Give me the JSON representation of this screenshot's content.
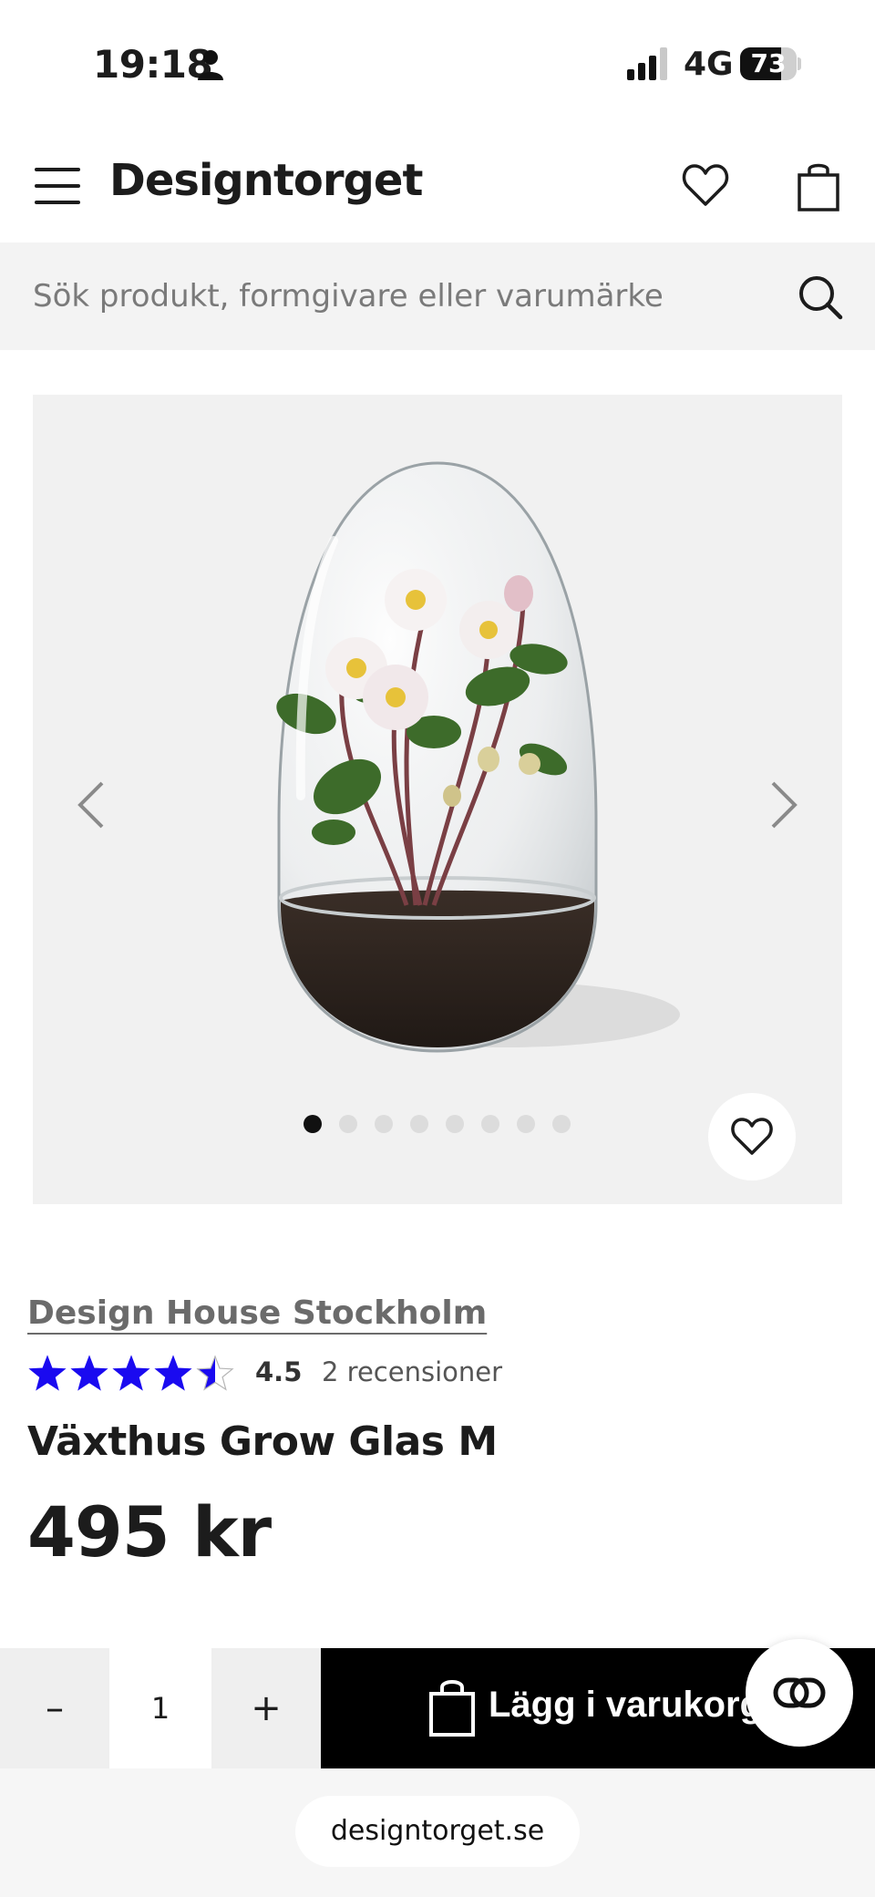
{
  "status_bar": {
    "time": "19:18",
    "network": "4G",
    "battery": "73",
    "battery_level": 0.73
  },
  "header": {
    "logo": "Designtorget",
    "menu_icon": "hamburger-menu-icon",
    "wishlist_icon": "heart-icon",
    "cart_icon": "shopping-bag-icon"
  },
  "search": {
    "placeholder": "Sök produkt, formgivare eller varumärke",
    "icon": "search-icon"
  },
  "gallery": {
    "image_alt": "product-photo",
    "image_count": 8,
    "active_index": 0,
    "prev_icon": "chevron-left-icon",
    "next_icon": "chevron-right-icon",
    "favorite_icon": "heart-icon"
  },
  "product": {
    "brand": "Design House Stockholm",
    "rating": 4.5,
    "rating_label": "4.5",
    "review_count": "2 recensioner",
    "title": "Växthus Grow Glas M",
    "price": "495 kr"
  },
  "cart": {
    "minus": "–",
    "quantity": "1",
    "plus": "+",
    "add_label": "Lägg i varukorgen",
    "chat_icon": "chat-icon"
  },
  "browser": {
    "url": "designtorget.se"
  },
  "colors": {
    "star": "#1a0af0",
    "brand_text": "#6b6b6b",
    "cart_button": "#000000",
    "search_bg": "#f3f3f3"
  }
}
